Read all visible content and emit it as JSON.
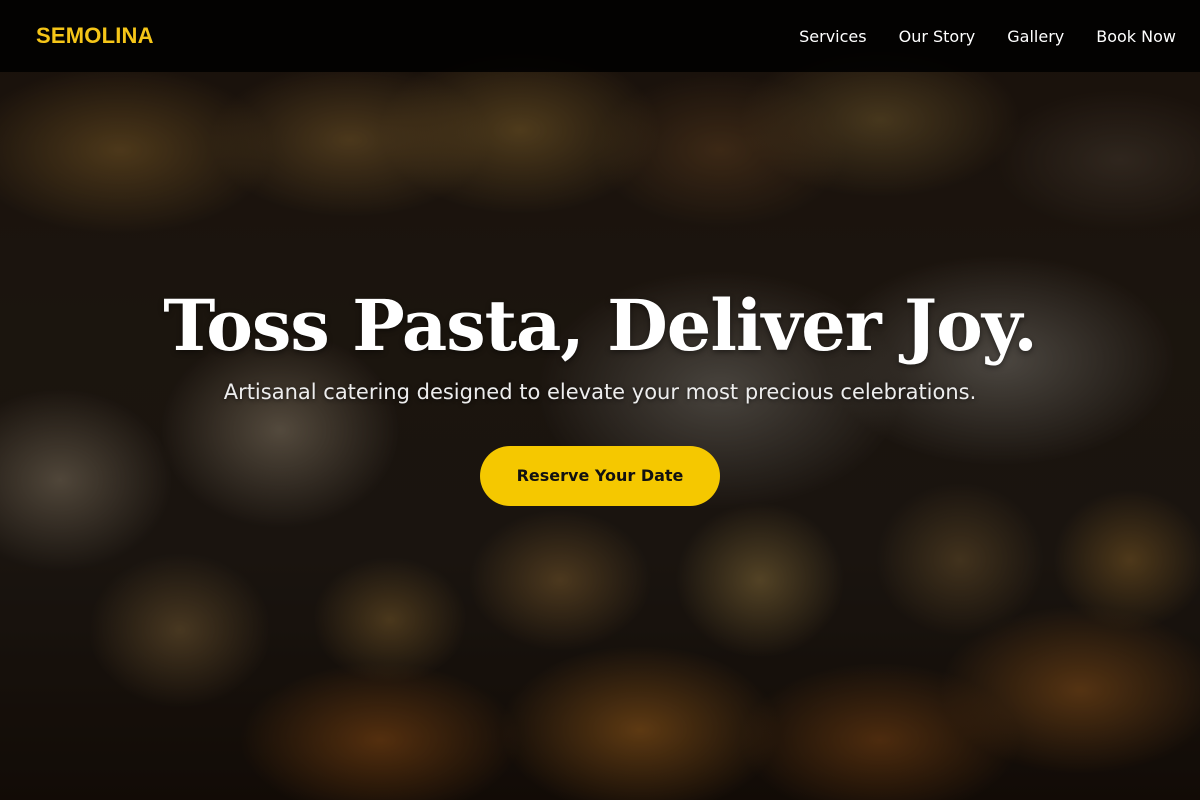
{
  "brand": {
    "name": "SEMOLINA",
    "color": "#f5c518"
  },
  "nav": {
    "items": [
      {
        "label": "Services"
      },
      {
        "label": "Our Story"
      },
      {
        "label": "Gallery"
      },
      {
        "label": "Book Now"
      }
    ]
  },
  "hero": {
    "title": "Toss Pasta, Deliver Joy.",
    "subtitle": "Artisanal catering designed to elevate your most precious celebrations.",
    "cta_label": "Reserve Your Date",
    "cta_color": "#f5c800",
    "background": "dark food platter photo (wraps, sushi-style rolls, pastries)"
  }
}
